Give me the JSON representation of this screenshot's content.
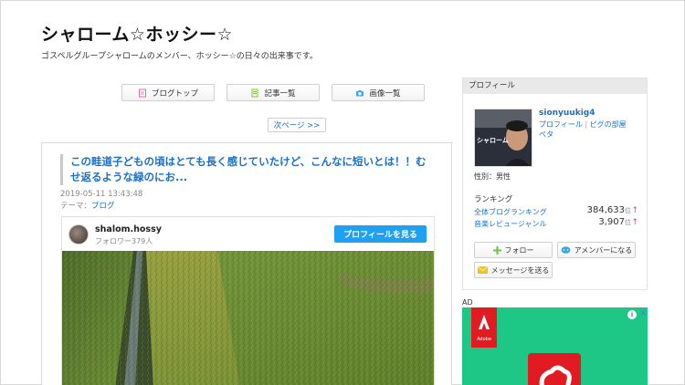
{
  "header": {
    "title": "シャローム☆ホッシー☆",
    "description": "ゴスペルグループシャロームのメンバー、ホッシー☆の日々の出来事です。"
  },
  "nav": {
    "blog_top": "ブログトップ",
    "articles": "記事一覧",
    "images": "画像一覧",
    "next_page": "次ページ >>"
  },
  "article": {
    "title": "この畦道子どもの頃はとても長く感じていたけど、こんなに短いとは！！むせ返るような緑のにお...",
    "date": "2019-05-11 13:43:48",
    "theme_label": "テーマ：",
    "theme": "ブログ"
  },
  "instagram": {
    "username": "shalom.hossy",
    "followers": "フォロワー379人",
    "profile_button": "プロフィールを見る"
  },
  "sidebar": {
    "heading": "プロフィール",
    "photo_caption": "シャローム",
    "username": "sionyuukig4",
    "link_profile": "プロフィール",
    "link_room": "ピグの部屋",
    "link_peta": "ペタ",
    "gender": "性別：男性",
    "ranking_title": "ランキング",
    "rankings": [
      {
        "label": "全体ブログランキング",
        "value": "384,633",
        "unit": "位",
        "arrow": "↑"
      },
      {
        "label": "音楽レビュージャンル",
        "value": "3,907",
        "unit": "位",
        "arrow": "↑"
      }
    ],
    "follow_button": "フォロー",
    "ameba_button": "アメンバーになる",
    "message_button": "メッセージを送る"
  },
  "ad": {
    "label": "AD",
    "logo_text": "Adobe",
    "info": "i",
    "close": "✕"
  },
  "colors": {
    "link": "#1a6fc7",
    "instagram_button": "#1fa0f0",
    "ad_background": "#1fc787",
    "adobe_red": "#e11b22",
    "rank_arrow": "#e0467a"
  }
}
